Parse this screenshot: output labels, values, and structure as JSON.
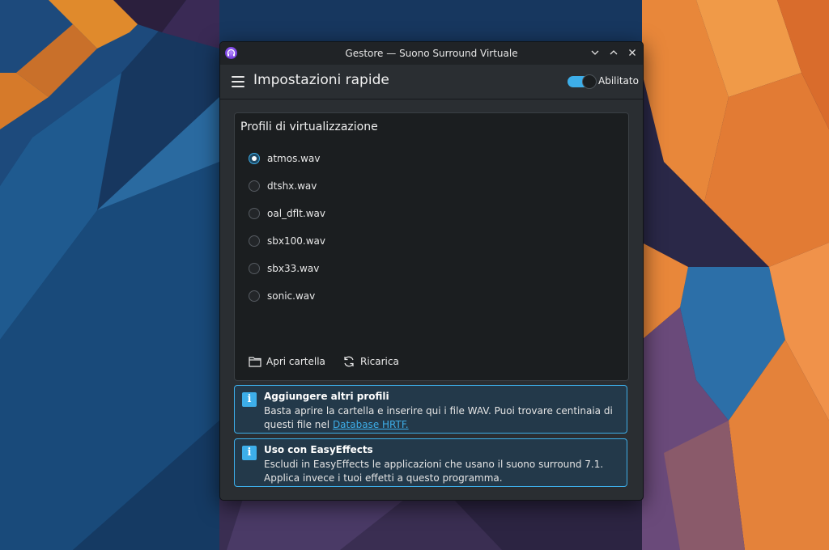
{
  "window": {
    "title": "Gestore — Suono Surround Virtuale"
  },
  "header": {
    "title": "Impostazioni rapide",
    "toggle_label": "Abilitato",
    "toggle_on": true
  },
  "profiles": {
    "title": "Profili di virtualizzazione",
    "items": [
      {
        "label": "atmos.wav",
        "checked": true
      },
      {
        "label": "dtshx.wav",
        "checked": false
      },
      {
        "label": "oal_dflt.wav",
        "checked": false
      },
      {
        "label": "sbx100.wav",
        "checked": false
      },
      {
        "label": "sbx33.wav",
        "checked": false
      },
      {
        "label": "sonic.wav",
        "checked": false
      }
    ],
    "open_folder_label": "Apri cartella",
    "reload_label": "Ricarica"
  },
  "info": {
    "add_profiles": {
      "title": "Aggiungere altri profili",
      "text": "Basta aprire la cartella e inserire qui i file WAV. Puoi trovare centinaia di questi file nel ",
      "link": "Database HRTF."
    },
    "easyeffects": {
      "title": "Uso con EasyEffects",
      "text": "Escludi in EasyEffects le applicazioni che usano il suono surround 7.1. Applica invece i tuoi effetti a questo programma."
    }
  },
  "colors": {
    "accent": "#3daee9",
    "window_bg": "#2a2e32",
    "panel_bg": "#1b1e20",
    "info_bg": "#23394a"
  }
}
